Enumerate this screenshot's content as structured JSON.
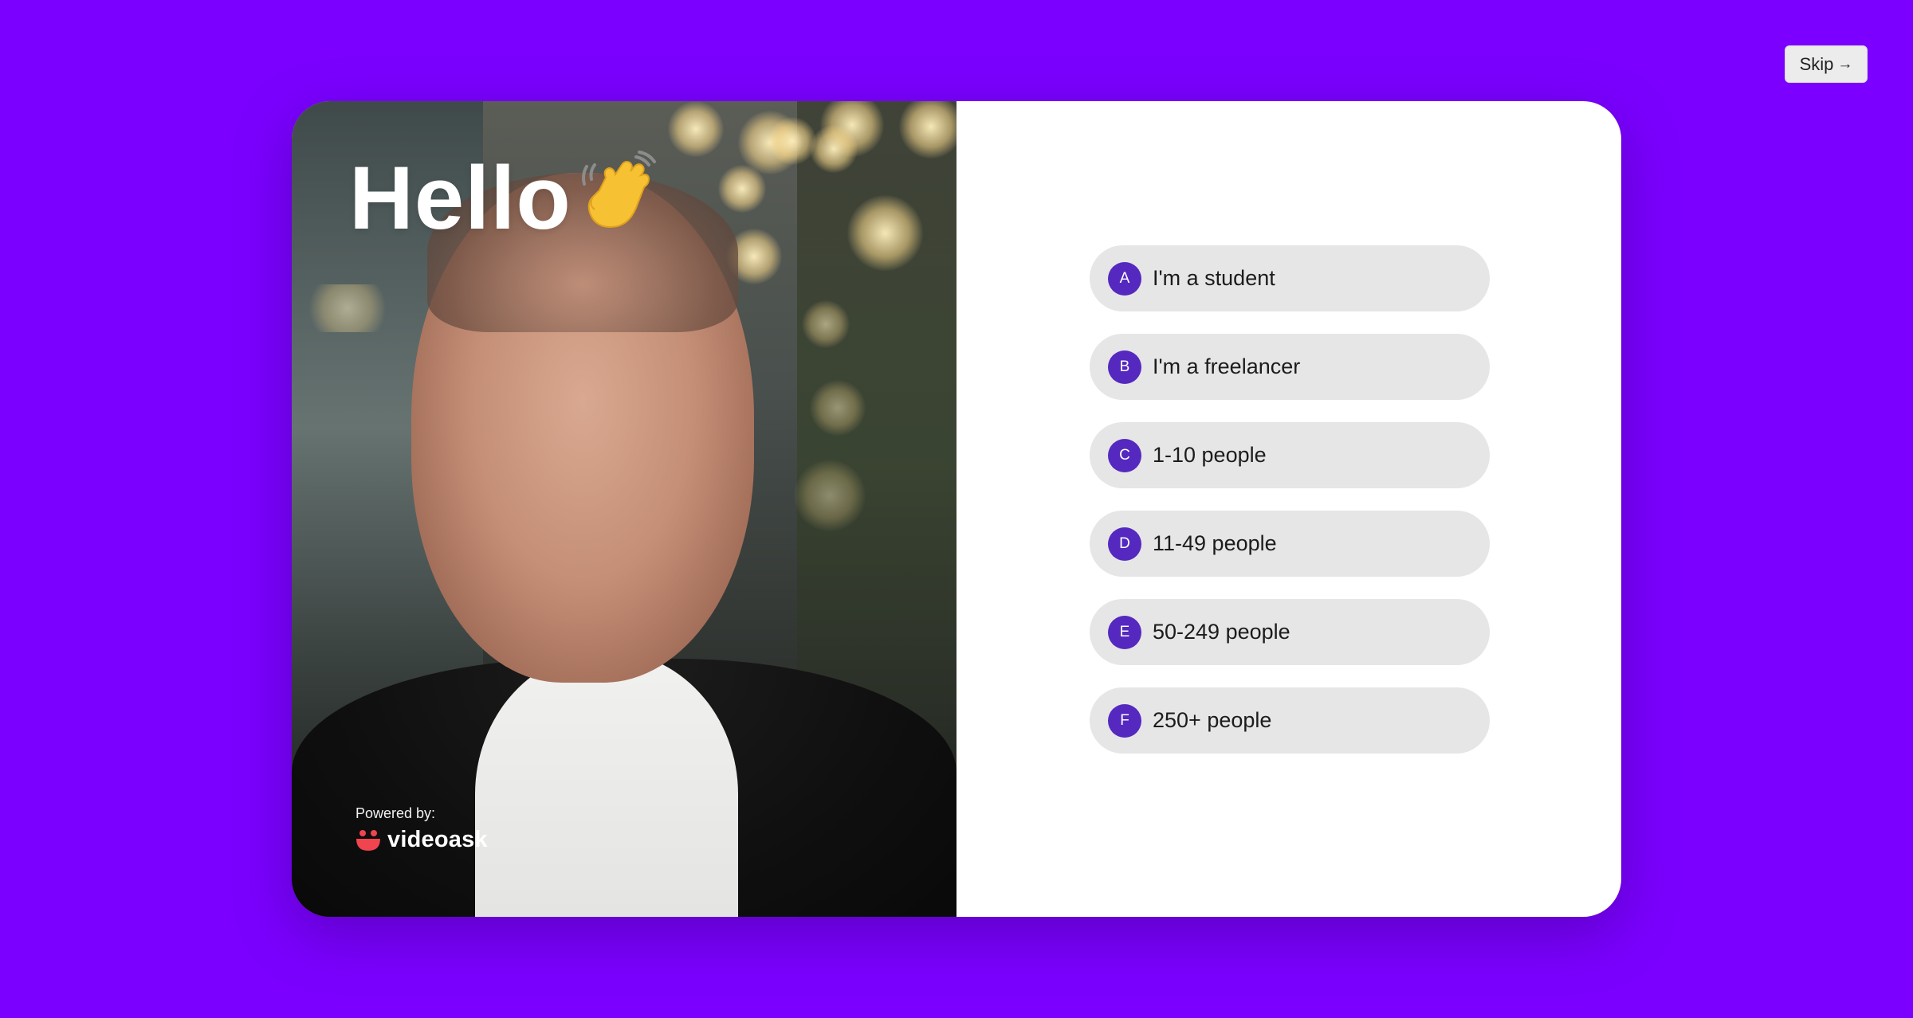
{
  "skip": {
    "label": "Skip",
    "icon": "arrow-right-icon"
  },
  "video": {
    "greeting": "Hello",
    "greeting_icon": "waving-hand-icon"
  },
  "branding": {
    "powered_label": "Powered by:",
    "logo_text": "videoask",
    "logo_icon": "videoask-logo-icon"
  },
  "choices": [
    {
      "letter": "A",
      "label": "I'm a student"
    },
    {
      "letter": "B",
      "label": "I'm a freelancer"
    },
    {
      "letter": "C",
      "label": "1-10 people"
    },
    {
      "letter": "D",
      "label": "11-49 people"
    },
    {
      "letter": "E",
      "label": "50-249 people"
    },
    {
      "letter": "F",
      "label": "250+ people"
    }
  ],
  "colors": {
    "background": "#7b00ff",
    "choice_badge": "#5528bf",
    "choice_bg": "#e6e6e6",
    "logo_red": "#f0444f"
  }
}
